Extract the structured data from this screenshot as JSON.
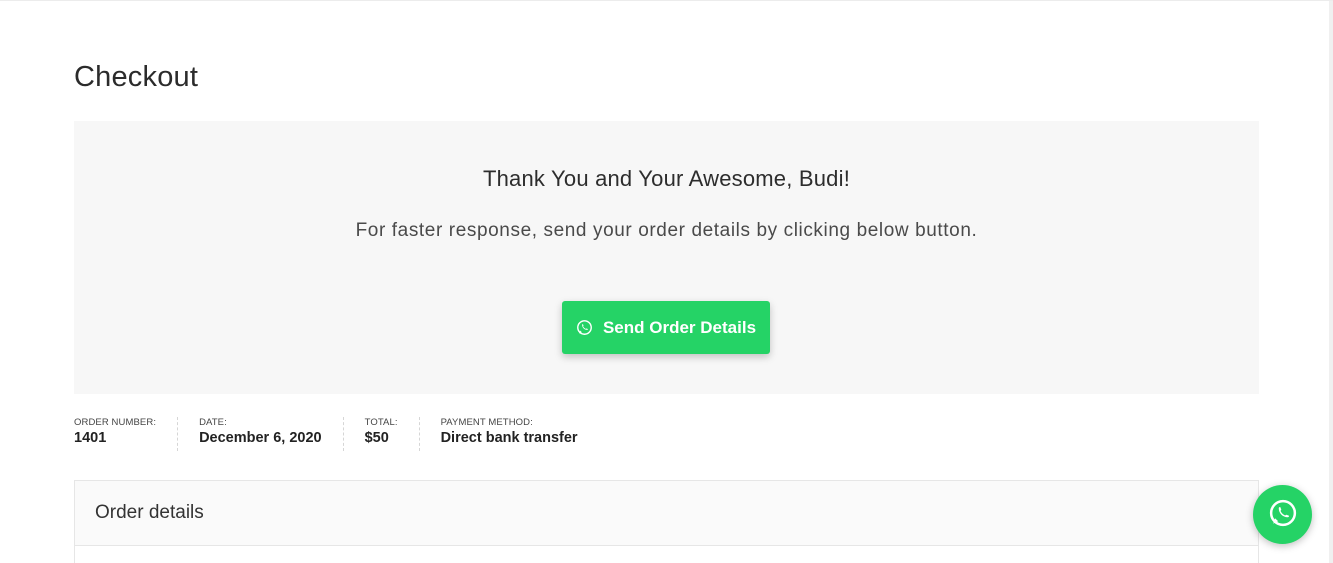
{
  "page": {
    "title": "Checkout"
  },
  "thankyou": {
    "heading": "Thank You and Your Awesome, Budi!",
    "text": "For faster response, send your order details by clicking below button.",
    "button_label": "Send Order Details",
    "button_icon": "whatsapp-icon",
    "button_color": "#25d366"
  },
  "overview": {
    "order_number": {
      "label": "ORDER NUMBER:",
      "value": "1401"
    },
    "date": {
      "label": "DATE:",
      "value": "December 6, 2020"
    },
    "total": {
      "label": "TOTAL:",
      "value": "$50"
    },
    "payment_method": {
      "label": "PAYMENT METHOD:",
      "value": "Direct bank transfer"
    }
  },
  "order_details": {
    "title": "Order details"
  },
  "floating_button": {
    "icon": "whatsapp-icon",
    "color": "#25d366"
  }
}
